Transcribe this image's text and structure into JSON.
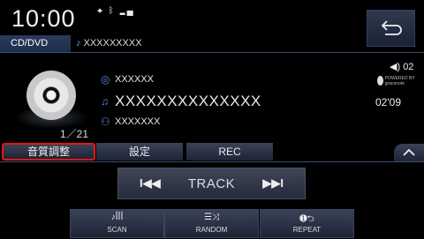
{
  "status": {
    "clock": "10:00",
    "icons": [
      "gps-icon",
      "bluetooth-icon",
      "signal-icon"
    ]
  },
  "source": {
    "tab_label": "CD/DVD",
    "header_track": "XXXXXXXXX"
  },
  "disc": {
    "count": "1／21"
  },
  "info": {
    "album": "XXXXXX",
    "title": "XXXXXXXXXXXXXX",
    "artist": "XXXXXXX"
  },
  "playback": {
    "volume": "02",
    "elapsed": "02'09",
    "gracenote_text": "POWERED BY gracenote"
  },
  "tabs": {
    "audio": "音質調整",
    "settings": "設定",
    "rec": "REC"
  },
  "controls": {
    "track_label": "TRACK",
    "scan": "SCAN",
    "random": "RANDOM",
    "repeat": "REPEAT"
  },
  "colors": {
    "accent_blue": "#5c8de0",
    "highlight_red": "#e01818"
  }
}
